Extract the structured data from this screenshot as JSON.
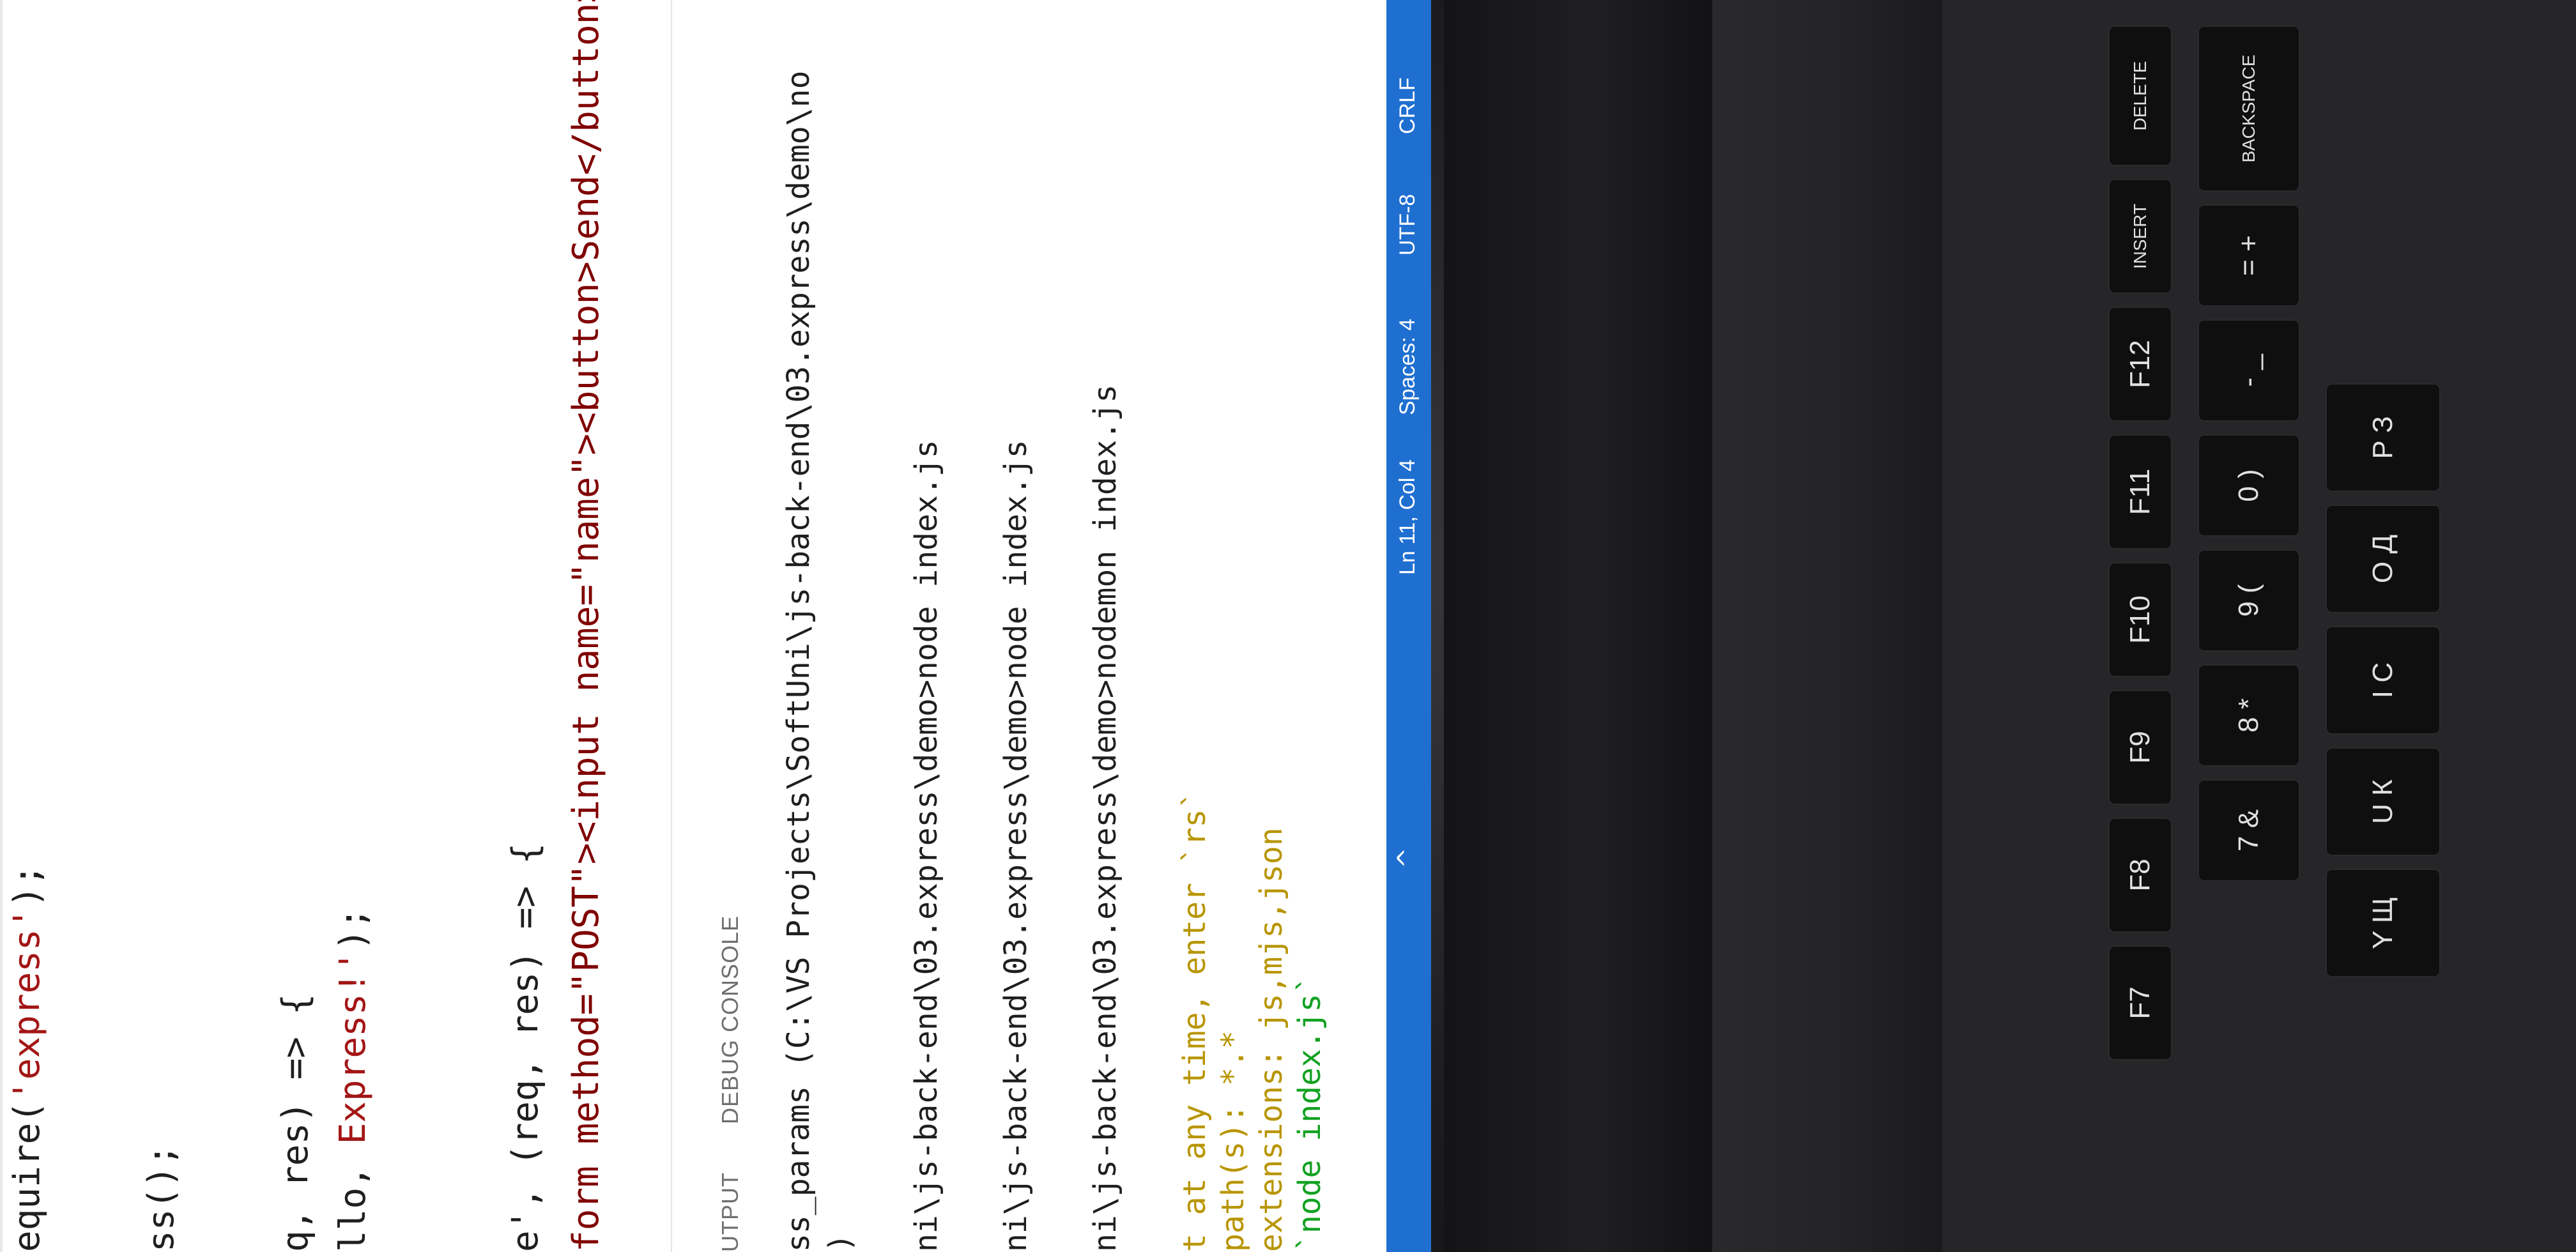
{
  "editor": {
    "lines": [
      {
        "plain": "equire(",
        "string": "'express'",
        "tail": ");"
      },
      {
        "plain": "ss();"
      },
      {
        "plain": "q, res) => {"
      },
      {
        "plain": "llo, ",
        "string": "Express!'",
        "tail": ");"
      },
      {
        "plain": "e', (req, res) => {"
      },
      {
        "plain": "form method=\"POST\"><input name=\"name\"><button>Send</button></"
      }
    ]
  },
  "panel": {
    "tabs": [
      "UTPUT",
      "DEBUG CONSOLE"
    ],
    "terminal_lines": [
      {
        "text": "ss_params (C:\\VS Projects\\SoftUni\\js-back-end\\03.express\\demo\\no",
        "style": "plain"
      },
      {
        "text": ")",
        "style": "plain"
      },
      {
        "text": "ni\\js-back-end\\03.express\\demo>node index.js",
        "style": "plain"
      },
      {
        "text": "ni\\js-back-end\\03.express\\demo>node index.js",
        "style": "plain"
      },
      {
        "text": "ni\\js-back-end\\03.express\\demo>nodemon index.js",
        "style": "plain"
      },
      {
        "text": "t at any time, enter `rs`",
        "style": "yellow"
      },
      {
        "text": "path(s): *.*",
        "style": "yellow"
      },
      {
        "text": "extensions: js,mjs,json",
        "style": "yellow"
      },
      {
        "text": "`node index.js`",
        "style": "green"
      }
    ]
  },
  "statusbar": {
    "position": "Ln 11, Col 4",
    "spaces": "Spaces: 4",
    "encoding": "UTF-8",
    "eol": "CRLF",
    "chevron": "^"
  },
  "keyboard": {
    "keys": [
      "DELETE",
      "INSERT",
      "F12",
      "F11",
      "F10",
      "F9",
      "F8",
      "F7",
      "BACKSPACE",
      "= +",
      "- _",
      "0 )",
      "9 (",
      "8 *",
      "7 &",
      "P З",
      "O Д",
      "I С",
      "U К",
      "Y Щ"
    ]
  },
  "colors": {
    "statusbar_bg": "#1f6fd1",
    "editor_bg": "#ffffff",
    "keyboard_bg": "#262628"
  }
}
